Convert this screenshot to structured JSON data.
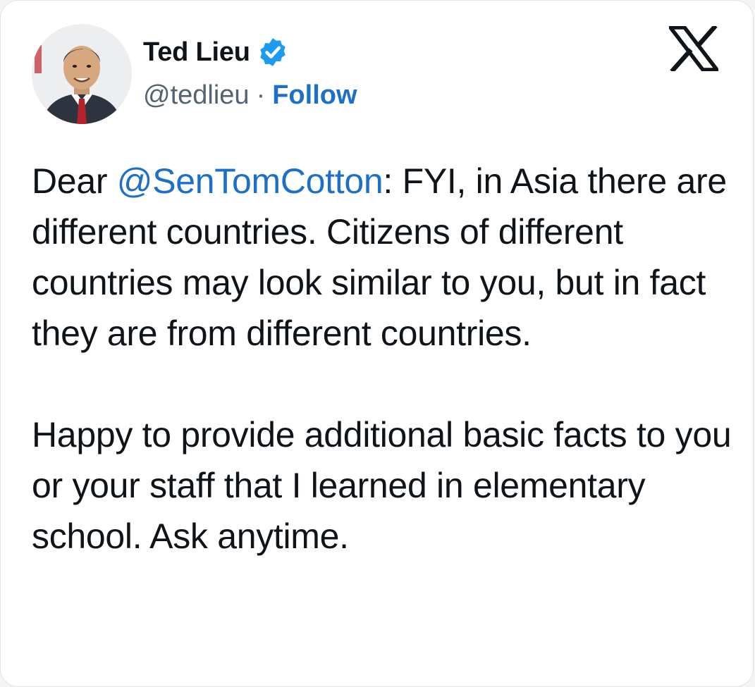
{
  "author": {
    "name": "Ted Lieu",
    "handle": "@tedlieu",
    "separator": "·",
    "follow_label": "Follow",
    "verified": true,
    "avatar_icon": "profile-photo",
    "verified_icon": "verified-badge-icon",
    "brand_icon": "x-logo-icon"
  },
  "tweet": {
    "para1_lead": "Dear ",
    "mention": "@SenTomCotton",
    "para1_rest": ": FYI, in Asia there are different countries. Citizens of different countries may look similar to you, but in fact they are from different countries.",
    "para2": "Happy to provide additional basic facts to you or your staff that I learned in elementary school. Ask anytime."
  },
  "colors": {
    "link": "#1d70c9",
    "text": "#0f1419",
    "secondary": "#536471",
    "verified": "#1d9bf0"
  }
}
